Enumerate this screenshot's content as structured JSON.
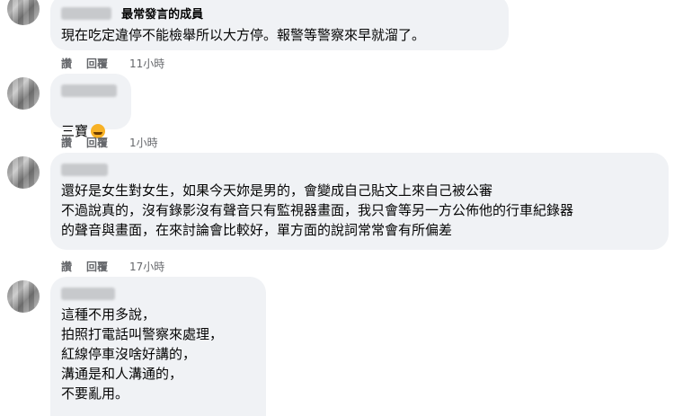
{
  "comments": [
    {
      "badge": "最常發言的成員",
      "text": "現在吃定違停不能檢舉所以大方停。報警等警察來早就溜了。",
      "like": "讚",
      "reply": "回覆",
      "time": "11小時"
    },
    {
      "text": "三寶",
      "emoji": "rolling-laughing-emoji",
      "like": "讚",
      "reply": "回覆",
      "time": "1小時"
    },
    {
      "text": "還好是女生對女生，如果今天妳是男的，會變成自己貼文上來自己被公審\n不過說真的，沒有錄影沒有聲音只有監視器畫面，我只會等另一方公佈他的行車紀錄器\n的聲音與畫面，在來討論會比較好，單方面的說詞常常會有所偏差",
      "like": "讚",
      "reply": "回覆",
      "time": "17小時"
    },
    {
      "text": "這種不用多說，\n拍照打電話叫警察來處理，\n紅線停車沒啥好講的，\n溝通是和人溝通的，\n不要亂用。"
    }
  ]
}
